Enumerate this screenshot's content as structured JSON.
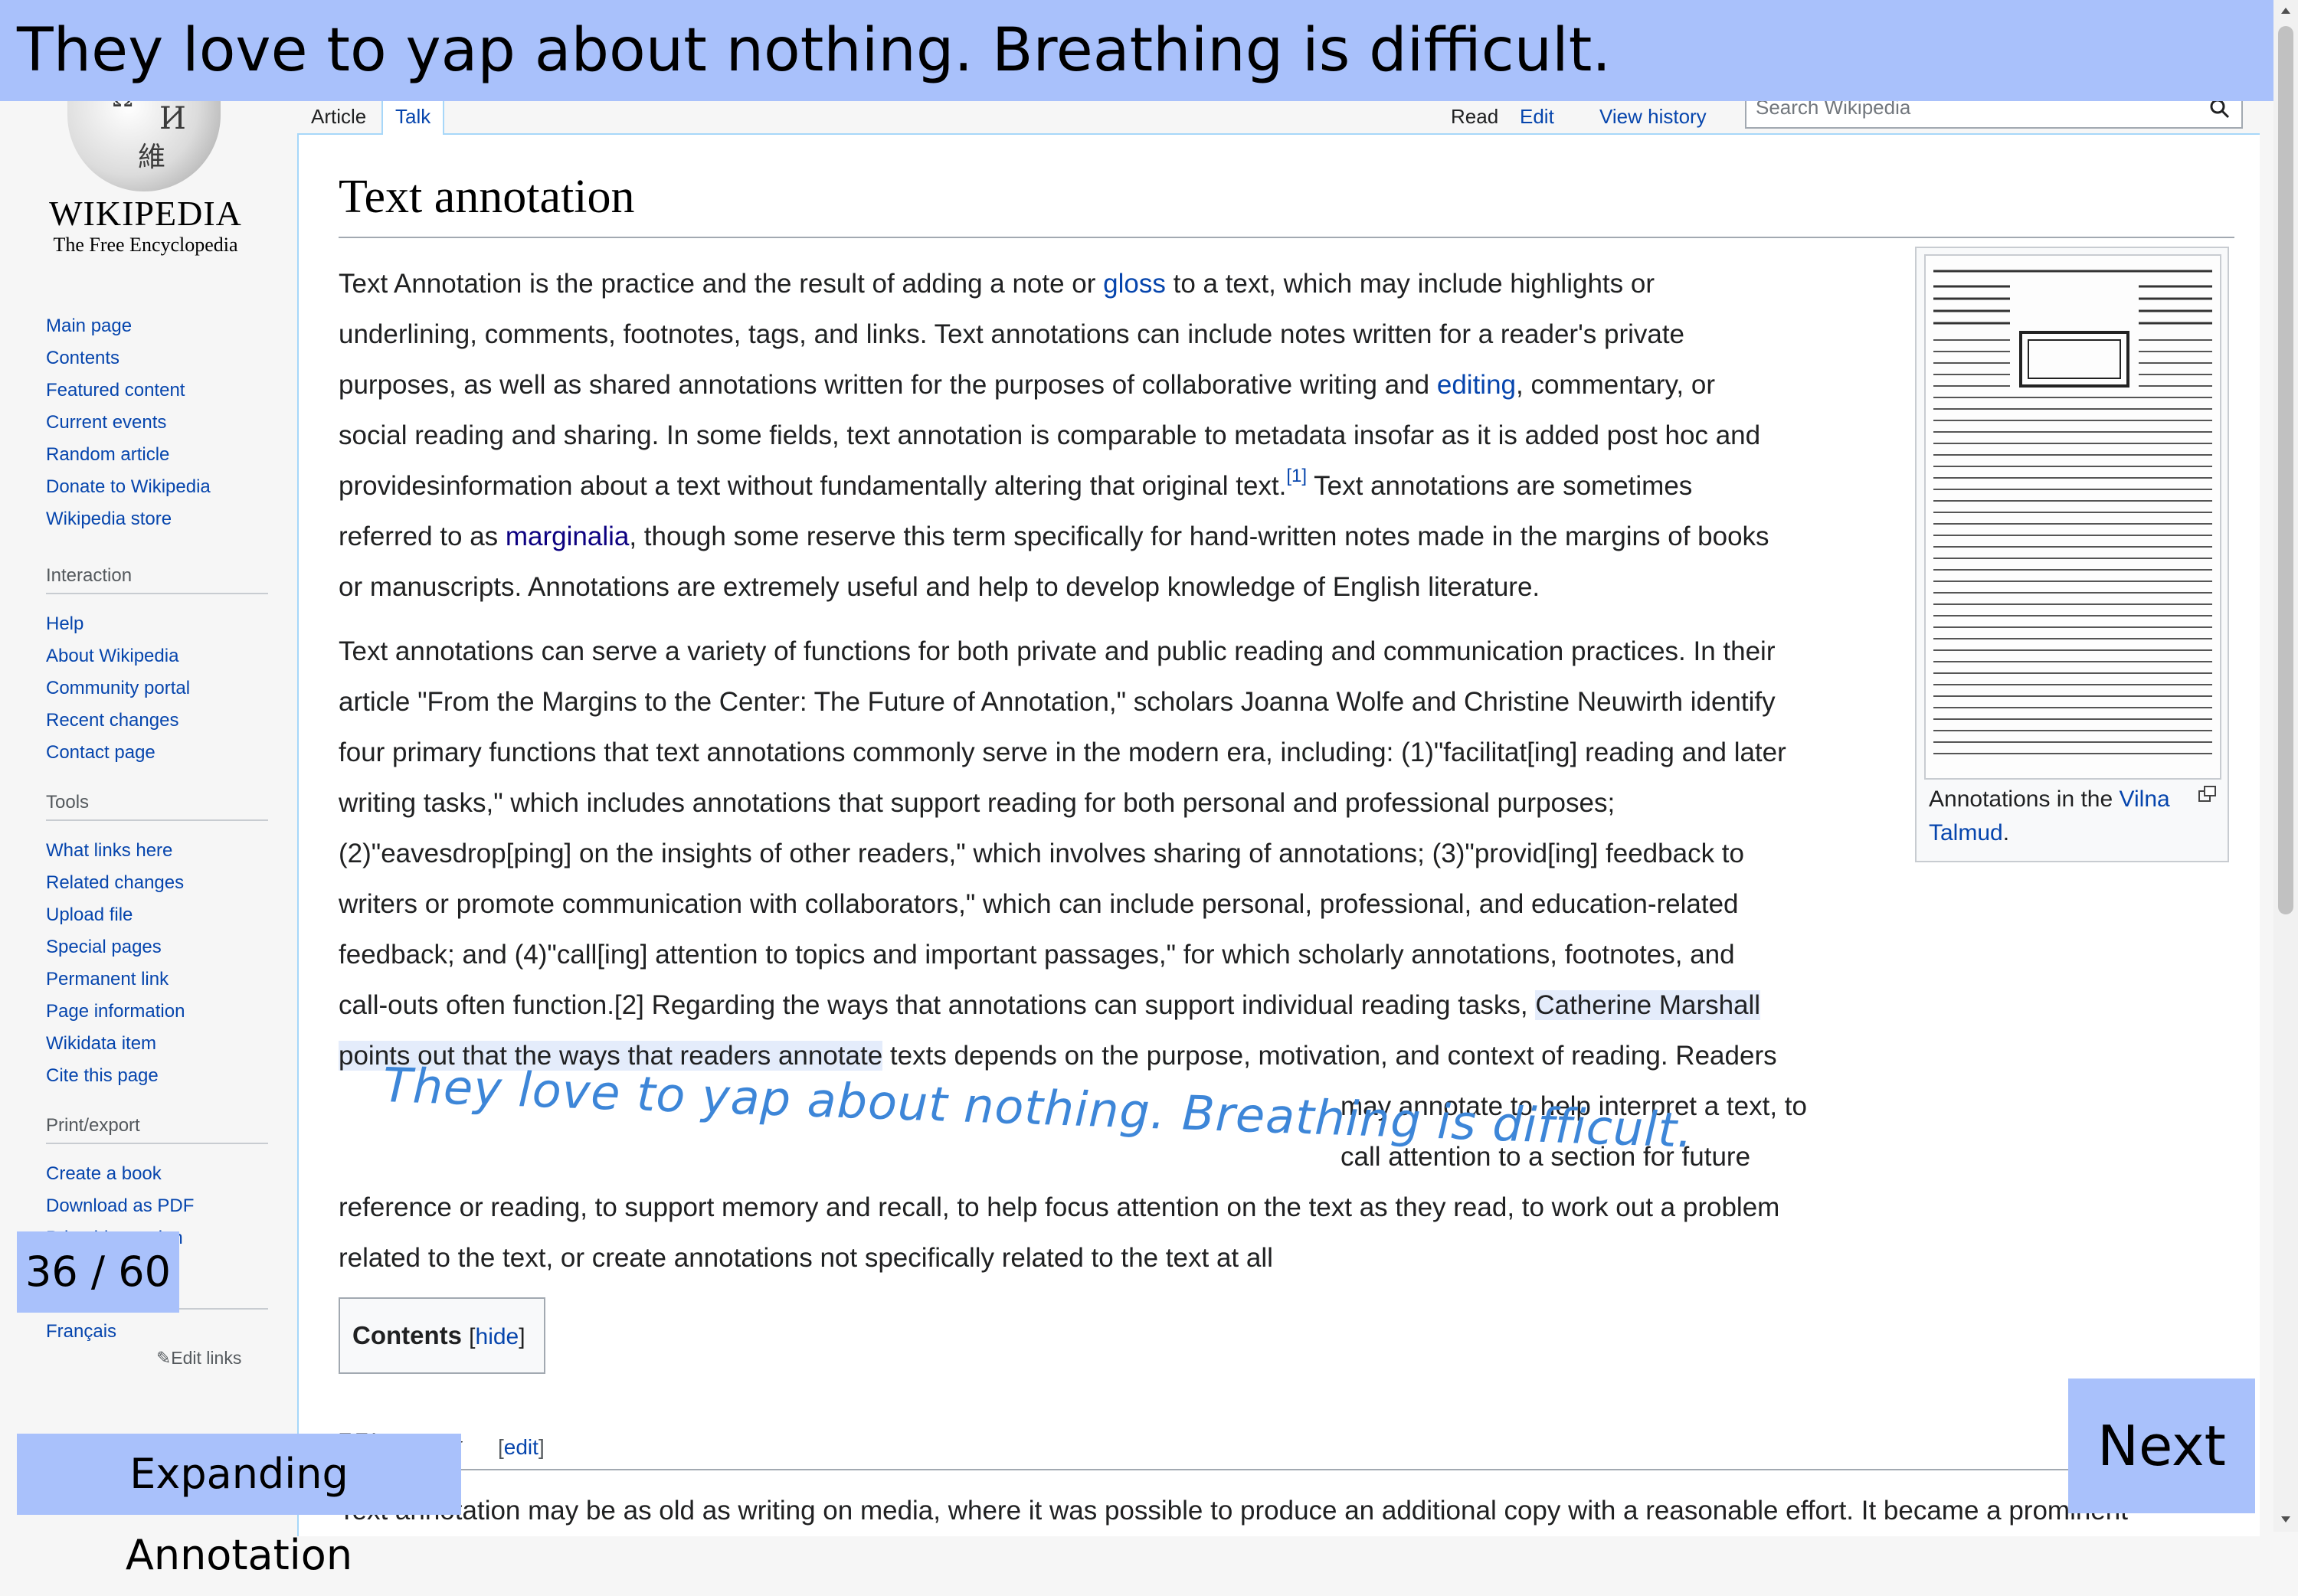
{
  "banner": {
    "text": "They love to yap about nothing. Breathing is difficult."
  },
  "logo": {
    "wordmark": "WIKIPEDIA",
    "tagline": "The Free Encyclopedia"
  },
  "sidebar": {
    "navigation": [
      "Main page",
      "Contents",
      "Featured content",
      "Current events",
      "Random article",
      "Donate to Wikipedia",
      "Wikipedia store"
    ],
    "interaction": {
      "heading": "Interaction",
      "items": [
        "Help",
        "About Wikipedia",
        "Community portal",
        "Recent changes",
        "Contact page"
      ]
    },
    "tools": {
      "heading": "Tools",
      "items": [
        "What links here",
        "Related changes",
        "Upload file",
        "Special pages",
        "Permanent link",
        "Page information",
        "Wikidata item",
        "Cite this page"
      ]
    },
    "print": {
      "heading": "Print/export",
      "items": [
        "Create a book",
        "Download as PDF",
        "Printable version"
      ]
    },
    "languages": {
      "items": [
        "Français"
      ],
      "edit_links": "Edit links"
    }
  },
  "tabs": {
    "article": "Article",
    "talk": "Talk",
    "read": "Read",
    "edit": "Edit",
    "view_history": "View history"
  },
  "search": {
    "placeholder": "Search Wikipedia"
  },
  "article": {
    "title": "Text annotation",
    "p1": {
      "l1a": "Text Annotation is the practice and the result of adding a note or ",
      "l1link": "gloss",
      "l1b": " to a text, which may include highlights or",
      "l2": "underlining, comments, footnotes, tags, and links. Text annotations can include notes written for a reader's private",
      "l3a": "purposes, as well as shared annotations written for the purposes of collaborative writing and ",
      "l3link": "editing",
      "l3b": ", commentary, or",
      "l4": "social reading and sharing. In some fields, text annotation is comparable to metadata insofar as it is added post hoc and",
      "l5a": "providesinformation about a text without fundamentally altering that original text.",
      "l5ref": "[1]",
      "l5b": " Text annotations are sometimes",
      "l6a": "referred to as ",
      "l6link": "marginalia",
      "l6b": ", though some reserve this term specifically for hand-written notes made in the margins of books",
      "l7": "or manuscripts. Annotations are extremely useful and help to develop knowledge of English literature."
    },
    "p2": {
      "l1": "Text annotations can serve a variety of functions for both private and public reading and communication practices. In their",
      "l2": "article \"From the Margins to the Center: The Future of Annotation,\" scholars Joanna Wolfe and Christine Neuwirth identify",
      "l3": "four primary functions that text annotations commonly serve in the modern era, including: (1)\"facilitat[ing] reading and later",
      "l4": "writing tasks,\" which includes annotations that support reading for both personal and professional purposes;",
      "l5": "(2)\"eavesdrop[ping] on the insights of other readers,\" which involves sharing of annotations; (3)\"provid[ing] feedback to",
      "l6": "writers or promote communication with collaborators,\" which can include personal, professional, and education-related",
      "l7": "feedback; and (4)\"call[ing] attention to topics and important passages,\" for which scholarly annotations, footnotes, and",
      "l8a": "call-outs often function.[2] Regarding the ways that annotations can support individual reading tasks, ",
      "l8hl": "Catherine Marshall",
      "l9hl": "points out that the ways that readers annotate",
      "l9b": " texts depends on the purpose, motivation, and context of reading. Readers",
      "l10": "may annotate to help interpret a text, to",
      "l11": "call attention to a section for future",
      "l12": "reference or reading, to support memory and recall, to help focus attention on the text as they read, to work out a problem",
      "l13": "related to the text, or create annotations not specifically related to the text at all"
    },
    "handwritten": "They love to yap about nothing. Breathing is difficult.",
    "thumb": {
      "caption_a": "Annotations in the ",
      "caption_link1": "Vilna",
      "caption_link2": "Talmud",
      "caption_b": "."
    },
    "toc": {
      "label": "Contents",
      "hide": "hide"
    },
    "history": {
      "heading": "History",
      "edit": "edit",
      "text": "Text annotation may be as old as writing on media, where it was possible to produce an additional copy with a reasonable effort. It became a prominent"
    }
  },
  "overlays": {
    "counter": "36 / 60",
    "mode": "Expanding Annotation",
    "next": "Next"
  },
  "colors": {
    "banner": "#a9c1fb",
    "link": "#0645ad",
    "highlight": "#e4ecfb",
    "handwriting": "#3d86d8"
  }
}
